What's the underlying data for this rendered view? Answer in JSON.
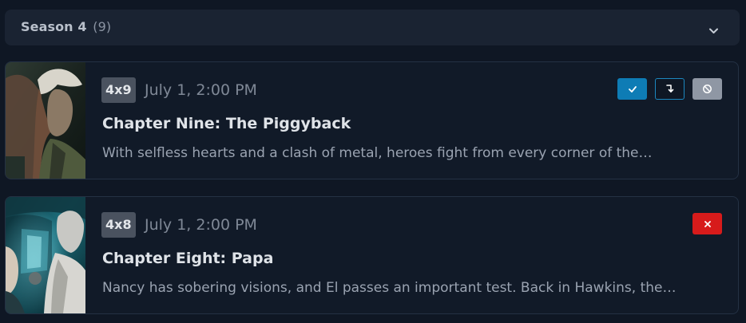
{
  "season": {
    "title": "Season 4",
    "count": "(9)",
    "icon": "chevron-down-icon"
  },
  "episodes": [
    {
      "code": "4x9",
      "date": "July 1, 2:00 PM",
      "title": "Chapter Nine: The Piggyback",
      "description": "With selfless hearts and a clash of metal, heroes fight from every corner of the…",
      "actions": [
        {
          "icon": "check-icon",
          "color": "#0e7cb5"
        },
        {
          "icon": "skip-arrow-icon",
          "color": "#1c87bf"
        },
        {
          "icon": "ignore-icon",
          "color": "#8f97a4"
        }
      ]
    },
    {
      "code": "4x8",
      "date": "July 1, 2:00 PM",
      "title": "Chapter Eight: Papa",
      "description": "Nancy has sobering visions, and El passes an important test. Back in Hawkins, the…",
      "actions": [
        {
          "icon": "close-icon",
          "color": "#d71b1b"
        }
      ]
    }
  ]
}
